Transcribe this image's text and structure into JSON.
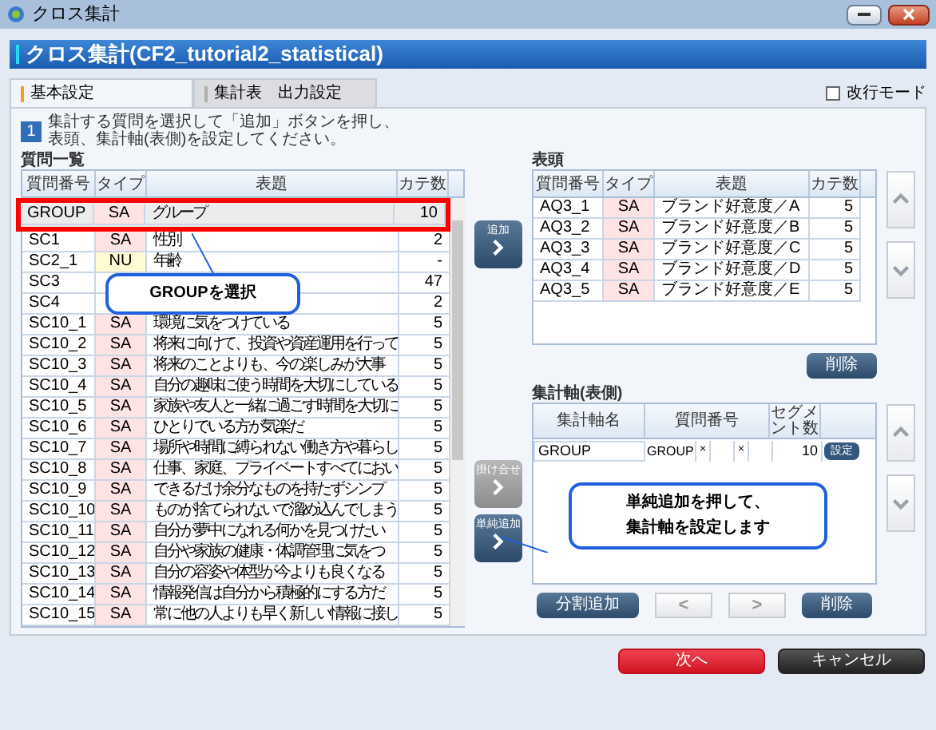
{
  "window": {
    "title": "クロス集計"
  },
  "header": {
    "title": "クロス集計(CF2_tutorial2_statistical)"
  },
  "line_mode": {
    "label": "改行モード",
    "checked": false
  },
  "tabs": [
    {
      "label": "基本設定",
      "selected": true
    },
    {
      "label": "集計表　出力設定",
      "selected": false
    }
  ],
  "step": {
    "number": "1",
    "lines": [
      "集計する質問を選択して「追加」ボタンを押し、",
      "表頭、集計軸(表側)を設定してください。"
    ]
  },
  "question_list": {
    "label": "質問一覧",
    "columns": [
      "質問番号",
      "タイプ",
      "表題",
      "カテ数"
    ],
    "rows": [
      {
        "id": "GROUP",
        "type": "SA",
        "kind": "single",
        "title": "グループ",
        "count": "10",
        "selected": true
      },
      {
        "id": "SC1",
        "type": "SA",
        "kind": "single",
        "title": "性別",
        "count": "2",
        "selected": false
      },
      {
        "id": "SC2_1",
        "type": "NU",
        "kind": "numeric",
        "title": "年齢",
        "count": "-",
        "selected": false
      },
      {
        "id": "SC3",
        "count": "47",
        "selected": false
      },
      {
        "id": "SC4",
        "count": "2",
        "selected": false
      },
      {
        "id": "SC10_1",
        "type": "SA",
        "kind": "single",
        "title": "環境に気をつけている",
        "count": "5",
        "selected": false
      },
      {
        "id": "SC10_2",
        "type": "SA",
        "kind": "single",
        "title": "将来に向けて、投資や資産運用を行って",
        "count": "5",
        "selected": false
      },
      {
        "id": "SC10_3",
        "type": "SA",
        "kind": "single",
        "title": "将来のことよりも、今の楽しみが大事",
        "count": "5",
        "selected": false
      },
      {
        "id": "SC10_4",
        "type": "SA",
        "kind": "single",
        "title": "自分の趣味に使う時間を大切にしている",
        "count": "5",
        "selected": false
      },
      {
        "id": "SC10_5",
        "type": "SA",
        "kind": "single",
        "title": "家族や友人と一緒に過ごす時間を大切に",
        "count": "5",
        "selected": false
      },
      {
        "id": "SC10_6",
        "type": "SA",
        "kind": "single",
        "title": "ひとりでいる方が気楽だ",
        "count": "5",
        "selected": false
      },
      {
        "id": "SC10_7",
        "type": "SA",
        "kind": "single",
        "title": "場所や時間に縛られない働き方や暮らし",
        "count": "5",
        "selected": false
      },
      {
        "id": "SC10_8",
        "type": "SA",
        "kind": "single",
        "title": "仕事、家庭、プライベートすべてにおい",
        "count": "5",
        "selected": false
      },
      {
        "id": "SC10_9",
        "type": "SA",
        "kind": "single",
        "title": "できるだけ余分なものを持たずシンプ",
        "count": "5",
        "selected": false
      },
      {
        "id": "SC10_10",
        "type": "SA",
        "kind": "single",
        "title": "ものが捨てられないで溜め込んでしまう",
        "count": "5",
        "selected": false
      },
      {
        "id": "SC10_11",
        "type": "SA",
        "kind": "single",
        "title": "自分が夢中になれる何かを見つけたい",
        "count": "5",
        "selected": false
      },
      {
        "id": "SC10_12",
        "type": "SA",
        "kind": "single",
        "title": "自分や家族の健康・体調管理に気をつ",
        "count": "5",
        "selected": false
      },
      {
        "id": "SC10_13",
        "type": "SA",
        "kind": "single",
        "title": "自分の容姿や体型が今よりも良くなる",
        "count": "5",
        "selected": false
      },
      {
        "id": "SC10_14",
        "type": "SA",
        "kind": "single",
        "title": "情報発信は自分から積極的にする方だ",
        "count": "5",
        "selected": false
      },
      {
        "id": "SC10_15",
        "type": "SA",
        "kind": "single",
        "title": "常に他の人よりも早く新しい情報に接し",
        "count": "5",
        "selected": false
      }
    ]
  },
  "middle_buttons": [
    {
      "label": "追加",
      "disabled": false
    },
    {
      "label": "掛け合せ",
      "disabled": true
    },
    {
      "label": "単純追加",
      "disabled": false
    }
  ],
  "column_head": {
    "label": "表頭",
    "columns": [
      "質問番号",
      "タイプ",
      "表題",
      "カテ数"
    ],
    "rows": [
      {
        "id": "AQ3_1",
        "type": "SA",
        "kind": "single",
        "title": "ブランド好意度／A",
        "count": "5"
      },
      {
        "id": "AQ3_2",
        "type": "SA",
        "kind": "single",
        "title": "ブランド好意度／B",
        "count": "5"
      },
      {
        "id": "AQ3_3",
        "type": "SA",
        "kind": "single",
        "title": "ブランド好意度／C",
        "count": "5"
      },
      {
        "id": "AQ3_4",
        "type": "SA",
        "kind": "single",
        "title": "ブランド好意度／D",
        "count": "5"
      },
      {
        "id": "AQ3_5",
        "type": "SA",
        "kind": "single",
        "title": "ブランド好意度／E",
        "count": "5"
      }
    ],
    "delete_button": "削除"
  },
  "axis": {
    "label": "集計軸(表側)",
    "columns": [
      "集計軸名",
      "質問番号",
      "セグメント数"
    ],
    "rows": [
      {
        "name": "GROUP",
        "q1": "GROUP",
        "x1": "×",
        "x2": "×",
        "segments": "10",
        "button": "設定"
      }
    ],
    "buttons": [
      {
        "label": "分割追加",
        "kind": "text"
      },
      {
        "label": "<",
        "kind": "nav"
      },
      {
        "label": ">",
        "kind": "nav"
      },
      {
        "label": "削除",
        "kind": "text"
      }
    ]
  },
  "callouts": [
    {
      "lines": [
        "GROUPを選択"
      ]
    },
    {
      "lines": [
        "単純追加を押して、",
        "集計軸を設定します"
      ]
    }
  ],
  "footer": {
    "next": "次へ",
    "cancel": "キャンセル"
  }
}
